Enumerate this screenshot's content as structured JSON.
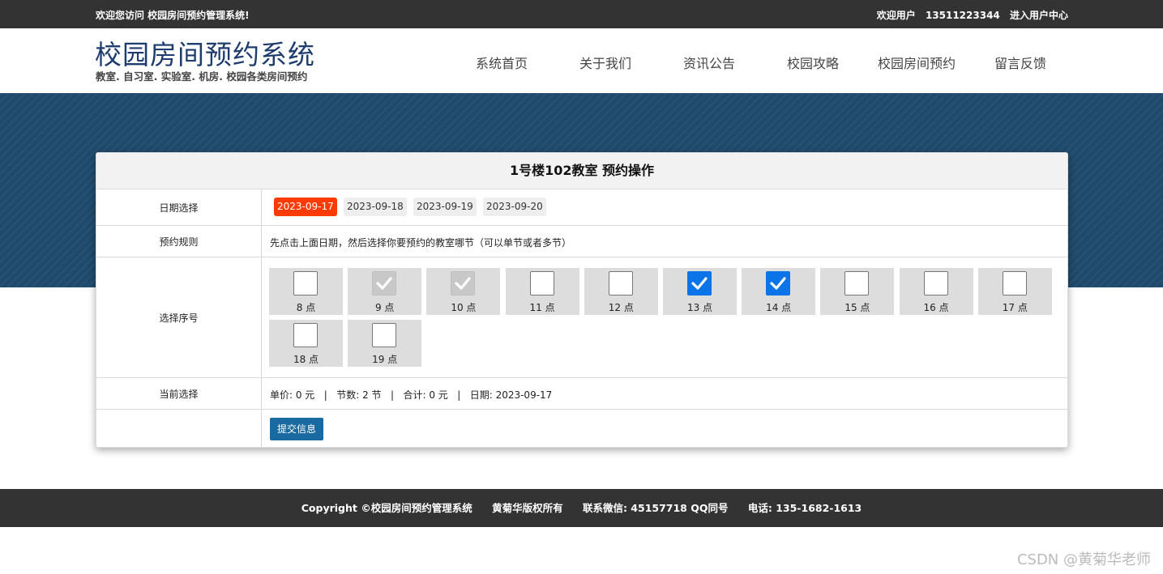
{
  "topbar": {
    "welcome": "欢迎您访问 校园房间预约管理系统!",
    "user_label": "欢迎用户",
    "user_phone": "13511223344",
    "user_center": "进入用户中心"
  },
  "header": {
    "title": "校园房间预约系统",
    "subtitle": "教室. 自习室. 实验室. 机房. 校园各类房间预约"
  },
  "nav": {
    "items": [
      "系统首页",
      "关于我们",
      "资讯公告",
      "校园攻略",
      "校园房间预约",
      "留言反馈"
    ]
  },
  "colors": {
    "banner": "#1f4a6c",
    "active_date": "#ff3b00",
    "checked": "#0a74e8",
    "submit": "#1a6aa2"
  },
  "panel": {
    "title": "1号楼102教室 预约操作",
    "date_label": "日期选择",
    "dates": [
      "2023-09-17",
      "2023-09-18",
      "2023-09-19",
      "2023-09-20"
    ],
    "active_date": "2023-09-17",
    "rule_label": "预约规则",
    "rule_text": "先点击上面日期，然后选择你要预约的教室哪节（可以单节或者多节）",
    "slots_label": "选择序号",
    "slots": [
      {
        "label": "8 点",
        "state": "empty"
      },
      {
        "label": "9 点",
        "state": "disabled"
      },
      {
        "label": "10 点",
        "state": "disabled"
      },
      {
        "label": "11 点",
        "state": "empty"
      },
      {
        "label": "12 点",
        "state": "empty"
      },
      {
        "label": "13 点",
        "state": "checked"
      },
      {
        "label": "14 点",
        "state": "checked"
      },
      {
        "label": "15 点",
        "state": "empty"
      },
      {
        "label": "16 点",
        "state": "empty"
      },
      {
        "label": "17 点",
        "state": "empty"
      },
      {
        "label": "18 点",
        "state": "empty"
      },
      {
        "label": "19 点",
        "state": "empty"
      }
    ],
    "current_label": "当前选择",
    "current_text": "单价: 0 元   |   节数: 2 节   |   合计: 0 元   |   日期: 2023-09-17",
    "submit_label": "提交信息"
  },
  "footer": {
    "copyright": "Copyright ©校园房间预约管理系统",
    "owner": "黄菊华版权所有",
    "wechat": "联系微信: 45157718 QQ同号",
    "phone": "电话: 135-1682-1613"
  },
  "watermark": "CSDN @黄菊华老师"
}
